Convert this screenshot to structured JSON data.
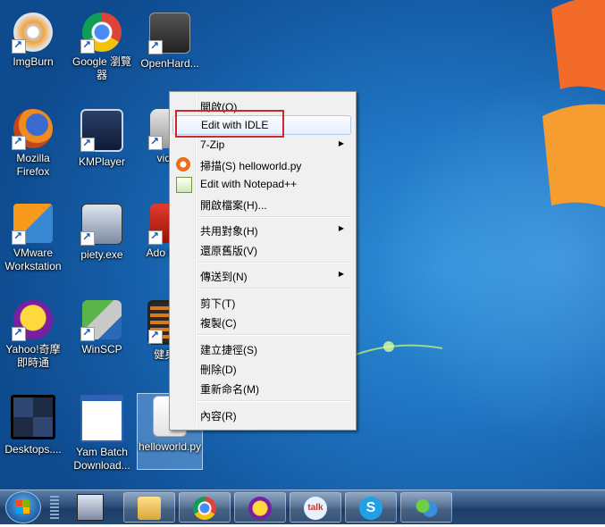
{
  "desktop": {
    "icons": [
      {
        "label": "ImgBurn"
      },
      {
        "label": "Google 瀏覽器"
      },
      {
        "label": "OpenHard..."
      },
      {
        "label": "Mozilla Firefox"
      },
      {
        "label": "KMPlayer"
      },
      {
        "label": "video"
      },
      {
        "label": "VMware Workstation"
      },
      {
        "label": "piety.exe"
      },
      {
        "label": "Ado Reac"
      },
      {
        "label": "Yahoo!奇摩即時通"
      },
      {
        "label": "WinSCP"
      },
      {
        "label": "健身指"
      },
      {
        "label": "Desktops...."
      },
      {
        "label": "Yam Batch Download..."
      },
      {
        "label": "helloworld.py"
      }
    ]
  },
  "context_menu": {
    "items": [
      {
        "label": "開啟(O)"
      },
      {
        "label": "Edit with IDLE"
      },
      {
        "label": "7-Zip"
      },
      {
        "label": "掃描(S) helloworld.py"
      },
      {
        "label": "Edit with Notepad++"
      },
      {
        "label": "開啟檔案(H)..."
      },
      {
        "label": "共用對象(H)"
      },
      {
        "label": "還原舊版(V)"
      },
      {
        "label": "傳送到(N)"
      },
      {
        "label": "剪下(T)"
      },
      {
        "label": "複製(C)"
      },
      {
        "label": "建立捷徑(S)"
      },
      {
        "label": "刪除(D)"
      },
      {
        "label": "重新命名(M)"
      },
      {
        "label": "內容(R)"
      }
    ],
    "highlight_color": "#d3262b"
  },
  "taskbar": {
    "apps": [
      {
        "icon": "windows-explorer-icon"
      },
      {
        "icon": "chrome-icon"
      },
      {
        "icon": "yahoo-messenger-icon"
      },
      {
        "icon": "google-talk-icon",
        "text": "talk"
      },
      {
        "icon": "skype-icon",
        "text": "S"
      },
      {
        "icon": "msn-messenger-icon"
      }
    ]
  }
}
